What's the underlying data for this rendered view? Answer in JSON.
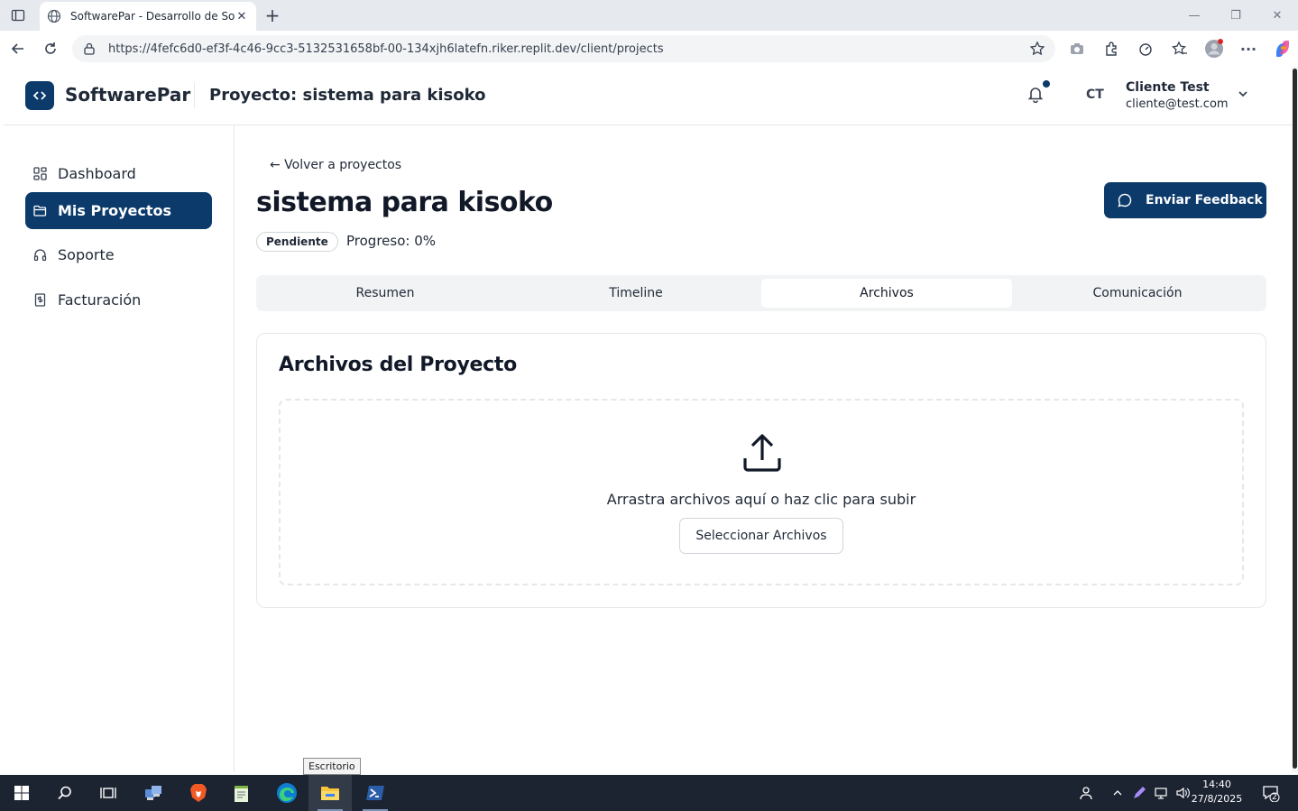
{
  "browser": {
    "tab_title": "SoftwarePar - Desarrollo de Softw",
    "url": "https://4fefc6d0-ef3f-4c46-9cc3-5132531658bf-00-134xjh6latefn.riker.replit.dev/client/projects"
  },
  "header": {
    "brand": "SoftwarePar",
    "project_title": "Proyecto: sistema para kisoko",
    "user_initials": "CT",
    "user_name": "Cliente Test",
    "user_email": "cliente@test.com"
  },
  "sidebar": {
    "items": [
      {
        "label": "Dashboard",
        "icon": "grid-icon"
      },
      {
        "label": "Mis Proyectos",
        "icon": "folder-icon",
        "active": true
      },
      {
        "label": "Soporte",
        "icon": "headphones-icon"
      },
      {
        "label": "Facturación",
        "icon": "receipt-icon"
      }
    ]
  },
  "main": {
    "back_link": "← Volver a proyectos",
    "project_name": "sistema para kisoko",
    "status": "Pendiente",
    "progress": "Progreso: 0%",
    "feedback_button": "Enviar Feedback",
    "tabs": [
      "Resumen",
      "Timeline",
      "Archivos",
      "Comunicación"
    ],
    "active_tab": "Archivos",
    "files_card": {
      "title": "Archivos del Proyecto",
      "drop_text": "Arrastra archivos aquí o haz clic para subir",
      "select_button": "Seleccionar Archivos"
    }
  },
  "tooltip": "Escritorio",
  "taskbar": {
    "time": "14:40",
    "date": "27/8/2025",
    "notification_count": "2"
  },
  "colors": {
    "primary": "#0b3a6b",
    "taskbar": "#1c2331"
  }
}
